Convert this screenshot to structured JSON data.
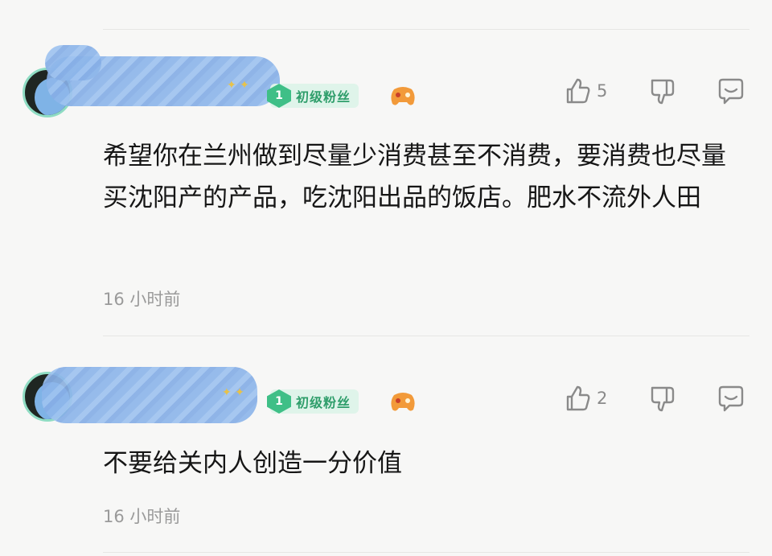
{
  "comments": [
    {
      "badge": {
        "level": "1",
        "label": "初级粉丝"
      },
      "like_count": "5",
      "text": "希望你在兰州做到尽量少消费甚至不消费，要消费也尽量买沈阳产的产品，吃沈阳出品的饭店。肥水不流外人田",
      "time": "16 小时前"
    },
    {
      "badge": {
        "level": "1",
        "label": "初级粉丝"
      },
      "like_count": "2",
      "text": "不要给关内人创造一分价值",
      "time": "16 小时前"
    }
  ],
  "icons": {
    "like": "thumbs-up-icon",
    "dislike": "thumbs-down-icon",
    "reply": "comment-icon",
    "fan_emblem": "gamepad-icon"
  },
  "colors": {
    "badge_green": "#3fbf87",
    "badge_text": "#2f9e6b",
    "muted": "#9a9a9a"
  }
}
